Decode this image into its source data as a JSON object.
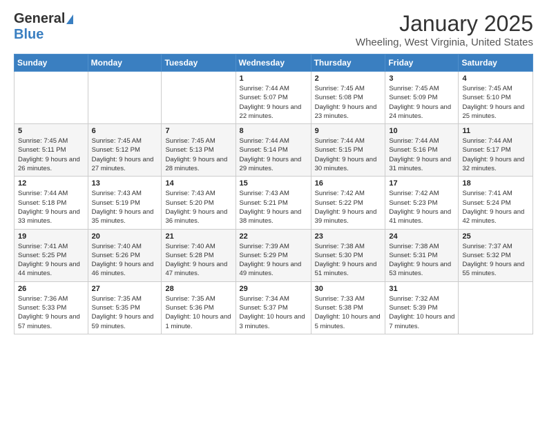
{
  "logo": {
    "general": "General",
    "blue": "Blue"
  },
  "header": {
    "title": "January 2025",
    "subtitle": "Wheeling, West Virginia, United States"
  },
  "weekdays": [
    "Sunday",
    "Monday",
    "Tuesday",
    "Wednesday",
    "Thursday",
    "Friday",
    "Saturday"
  ],
  "weeks": [
    [
      {
        "day": "",
        "info": ""
      },
      {
        "day": "",
        "info": ""
      },
      {
        "day": "",
        "info": ""
      },
      {
        "day": "1",
        "info": "Sunrise: 7:44 AM\nSunset: 5:07 PM\nDaylight: 9 hours and 22 minutes."
      },
      {
        "day": "2",
        "info": "Sunrise: 7:45 AM\nSunset: 5:08 PM\nDaylight: 9 hours and 23 minutes."
      },
      {
        "day": "3",
        "info": "Sunrise: 7:45 AM\nSunset: 5:09 PM\nDaylight: 9 hours and 24 minutes."
      },
      {
        "day": "4",
        "info": "Sunrise: 7:45 AM\nSunset: 5:10 PM\nDaylight: 9 hours and 25 minutes."
      }
    ],
    [
      {
        "day": "5",
        "info": "Sunrise: 7:45 AM\nSunset: 5:11 PM\nDaylight: 9 hours and 26 minutes."
      },
      {
        "day": "6",
        "info": "Sunrise: 7:45 AM\nSunset: 5:12 PM\nDaylight: 9 hours and 27 minutes."
      },
      {
        "day": "7",
        "info": "Sunrise: 7:45 AM\nSunset: 5:13 PM\nDaylight: 9 hours and 28 minutes."
      },
      {
        "day": "8",
        "info": "Sunrise: 7:44 AM\nSunset: 5:14 PM\nDaylight: 9 hours and 29 minutes."
      },
      {
        "day": "9",
        "info": "Sunrise: 7:44 AM\nSunset: 5:15 PM\nDaylight: 9 hours and 30 minutes."
      },
      {
        "day": "10",
        "info": "Sunrise: 7:44 AM\nSunset: 5:16 PM\nDaylight: 9 hours and 31 minutes."
      },
      {
        "day": "11",
        "info": "Sunrise: 7:44 AM\nSunset: 5:17 PM\nDaylight: 9 hours and 32 minutes."
      }
    ],
    [
      {
        "day": "12",
        "info": "Sunrise: 7:44 AM\nSunset: 5:18 PM\nDaylight: 9 hours and 33 minutes."
      },
      {
        "day": "13",
        "info": "Sunrise: 7:43 AM\nSunset: 5:19 PM\nDaylight: 9 hours and 35 minutes."
      },
      {
        "day": "14",
        "info": "Sunrise: 7:43 AM\nSunset: 5:20 PM\nDaylight: 9 hours and 36 minutes."
      },
      {
        "day": "15",
        "info": "Sunrise: 7:43 AM\nSunset: 5:21 PM\nDaylight: 9 hours and 38 minutes."
      },
      {
        "day": "16",
        "info": "Sunrise: 7:42 AM\nSunset: 5:22 PM\nDaylight: 9 hours and 39 minutes."
      },
      {
        "day": "17",
        "info": "Sunrise: 7:42 AM\nSunset: 5:23 PM\nDaylight: 9 hours and 41 minutes."
      },
      {
        "day": "18",
        "info": "Sunrise: 7:41 AM\nSunset: 5:24 PM\nDaylight: 9 hours and 42 minutes."
      }
    ],
    [
      {
        "day": "19",
        "info": "Sunrise: 7:41 AM\nSunset: 5:25 PM\nDaylight: 9 hours and 44 minutes."
      },
      {
        "day": "20",
        "info": "Sunrise: 7:40 AM\nSunset: 5:26 PM\nDaylight: 9 hours and 46 minutes."
      },
      {
        "day": "21",
        "info": "Sunrise: 7:40 AM\nSunset: 5:28 PM\nDaylight: 9 hours and 47 minutes."
      },
      {
        "day": "22",
        "info": "Sunrise: 7:39 AM\nSunset: 5:29 PM\nDaylight: 9 hours and 49 minutes."
      },
      {
        "day": "23",
        "info": "Sunrise: 7:38 AM\nSunset: 5:30 PM\nDaylight: 9 hours and 51 minutes."
      },
      {
        "day": "24",
        "info": "Sunrise: 7:38 AM\nSunset: 5:31 PM\nDaylight: 9 hours and 53 minutes."
      },
      {
        "day": "25",
        "info": "Sunrise: 7:37 AM\nSunset: 5:32 PM\nDaylight: 9 hours and 55 minutes."
      }
    ],
    [
      {
        "day": "26",
        "info": "Sunrise: 7:36 AM\nSunset: 5:33 PM\nDaylight: 9 hours and 57 minutes."
      },
      {
        "day": "27",
        "info": "Sunrise: 7:35 AM\nSunset: 5:35 PM\nDaylight: 9 hours and 59 minutes."
      },
      {
        "day": "28",
        "info": "Sunrise: 7:35 AM\nSunset: 5:36 PM\nDaylight: 10 hours and 1 minute."
      },
      {
        "day": "29",
        "info": "Sunrise: 7:34 AM\nSunset: 5:37 PM\nDaylight: 10 hours and 3 minutes."
      },
      {
        "day": "30",
        "info": "Sunrise: 7:33 AM\nSunset: 5:38 PM\nDaylight: 10 hours and 5 minutes."
      },
      {
        "day": "31",
        "info": "Sunrise: 7:32 AM\nSunset: 5:39 PM\nDaylight: 10 hours and 7 minutes."
      },
      {
        "day": "",
        "info": ""
      }
    ]
  ]
}
